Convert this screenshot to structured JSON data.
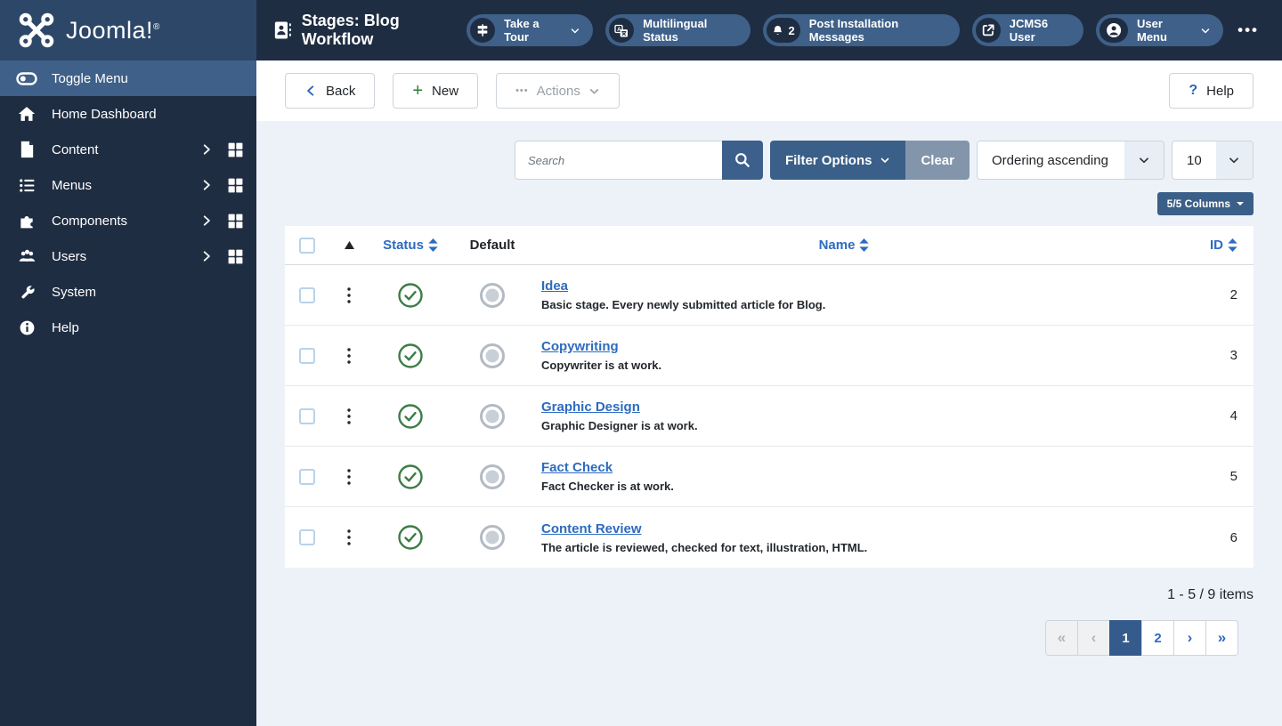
{
  "topbar": {
    "logo_text": "Joomla!",
    "logo_reg": "®",
    "title": "Stages: Blog Workflow",
    "tour_label": "Take a Tour",
    "multilingual_label": "Multilingual Status",
    "messages_count": "2",
    "messages_label": "Post Installation Messages",
    "site_label": "JCMS6 User",
    "user_label": "User Menu",
    "more_glyph": "•••"
  },
  "sidebar": {
    "items": [
      {
        "label": "Toggle Menu"
      },
      {
        "label": "Home Dashboard"
      },
      {
        "label": "Content"
      },
      {
        "label": "Menus"
      },
      {
        "label": "Components"
      },
      {
        "label": "Users"
      },
      {
        "label": "System"
      },
      {
        "label": "Help"
      }
    ]
  },
  "toolbar": {
    "back_label": "Back",
    "new_label": "New",
    "new_glyph": "+",
    "actions_label": "Actions",
    "actions_glyph": "•••",
    "help_label": "Help",
    "help_glyph": "?"
  },
  "filters": {
    "search_placeholder": "Search",
    "filter_options_label": "Filter Options",
    "clear_label": "Clear",
    "ordering_value": "Ordering ascending",
    "limit_value": "10",
    "columns_label": "5/5 Columns"
  },
  "table": {
    "headers": {
      "status": "Status",
      "default": "Default",
      "name": "Name",
      "id": "ID"
    },
    "rows": [
      {
        "name": "Idea",
        "description": "Basic stage. Every newly submitted article for Blog.",
        "id": "2"
      },
      {
        "name": "Copywriting",
        "description": "Copywriter is at work.",
        "id": "3"
      },
      {
        "name": "Graphic Design",
        "description": "Graphic Designer is at work.",
        "id": "4"
      },
      {
        "name": "Fact Check",
        "description": "Fact Checker is at work.",
        "id": "5"
      },
      {
        "name": "Content Review",
        "description": "The article is reviewed, checked for text, illustration, HTML.",
        "id": "6"
      }
    ]
  },
  "pagination": {
    "counter": "1 - 5 / 9 items",
    "first_glyph": "«",
    "prev_glyph": "‹",
    "page_current": "1",
    "page_next": "2",
    "next_glyph": "›",
    "last_glyph": "»"
  },
  "colors": {
    "topbar_bg": "#1f2d42",
    "logo_bg": "#2d4768",
    "accent_steel": "#3a5f88",
    "link_blue": "#2d6bc0",
    "success_green": "#3c7d46",
    "clear_gray": "#8295ab",
    "page_bg": "#edf2f9",
    "active_page": "#355a8c"
  }
}
